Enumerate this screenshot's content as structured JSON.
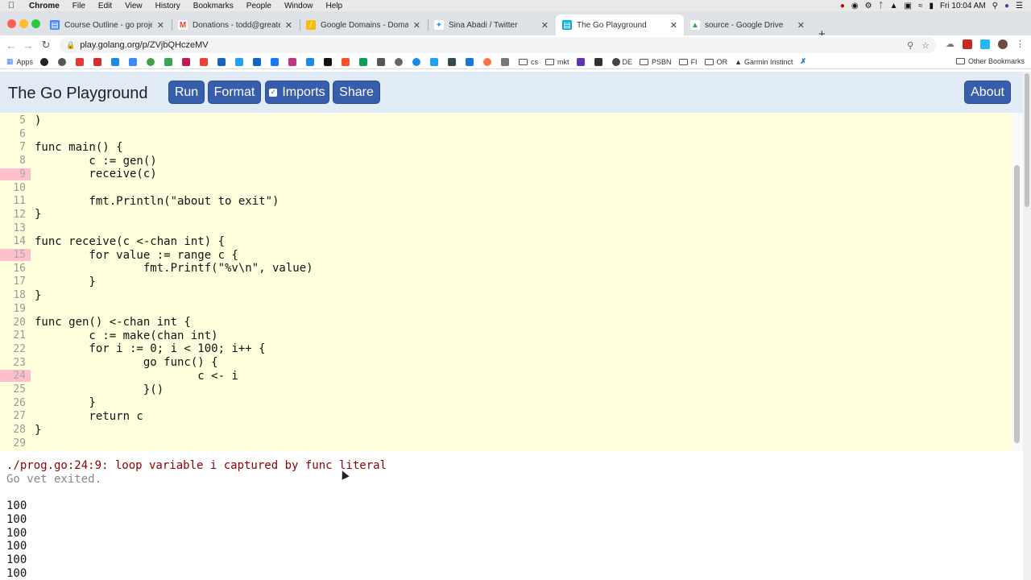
{
  "menubar": {
    "app": "Chrome",
    "items": [
      "File",
      "Edit",
      "View",
      "History",
      "Bookmarks",
      "People",
      "Window",
      "Help"
    ],
    "clock": "Fri 10:04 AM"
  },
  "tabs": [
    {
      "title": "Course Outline - go project - G",
      "icon": "google-docs-icon",
      "color": "#4285f4"
    },
    {
      "title": "Donations - todd@greatercom",
      "icon": "gmail-icon",
      "color": "#ea4335"
    },
    {
      "title": "Google Domains - Domain ove",
      "icon": "google-domains-icon",
      "color": "#fbbc04"
    },
    {
      "title": "Sina Abadi / Twitter",
      "icon": "twitter-icon",
      "color": "#1da1f2"
    },
    {
      "title": "The Go Playground",
      "icon": "go-playground-icon",
      "color": "#00add8"
    },
    {
      "title": "source - Google Drive",
      "icon": "google-drive-icon",
      "color": "#34a853"
    }
  ],
  "address": {
    "url": "play.golang.org/p/ZVjbQHczeMV"
  },
  "bookmarks": {
    "apps": "Apps",
    "labeled": [
      "cs",
      "mkt",
      "DE",
      "PSBN",
      "FI",
      "OR",
      "Garmin Instinct"
    ],
    "other": "Other Bookmarks"
  },
  "playground": {
    "title": "The Go Playground",
    "run": "Run",
    "format": "Format",
    "imports": "Imports",
    "share": "Share",
    "about": "About"
  },
  "code": [
    {
      "n": "5",
      "text": ")",
      "err": false
    },
    {
      "n": "6",
      "text": "",
      "err": false
    },
    {
      "n": "7",
      "text": "func main() {",
      "err": false
    },
    {
      "n": "8",
      "text": "        c := gen()",
      "err": false
    },
    {
      "n": "9",
      "text": "        receive(c)",
      "err": true
    },
    {
      "n": "10",
      "text": "",
      "err": false
    },
    {
      "n": "11",
      "text": "        fmt.Println(\"about to exit\")",
      "err": false
    },
    {
      "n": "12",
      "text": "}",
      "err": false
    },
    {
      "n": "13",
      "text": "",
      "err": false
    },
    {
      "n": "14",
      "text": "func receive(c <-chan int) {",
      "err": false
    },
    {
      "n": "15",
      "text": "        for value := range c {",
      "err": true
    },
    {
      "n": "16",
      "text": "                fmt.Printf(\"%v\\n\", value)",
      "err": false
    },
    {
      "n": "17",
      "text": "        }",
      "err": false
    },
    {
      "n": "18",
      "text": "}",
      "err": false
    },
    {
      "n": "19",
      "text": "",
      "err": false
    },
    {
      "n": "20",
      "text": "func gen() <-chan int {",
      "err": false
    },
    {
      "n": "21",
      "text": "        c := make(chan int)",
      "err": false
    },
    {
      "n": "22",
      "text": "        for i := 0; i < 100; i++ {",
      "err": false
    },
    {
      "n": "23",
      "text": "                go func() {",
      "err": false
    },
    {
      "n": "24",
      "text": "                        c <- i",
      "err": true
    },
    {
      "n": "25",
      "text": "                }()",
      "err": false
    },
    {
      "n": "26",
      "text": "        }",
      "err": false
    },
    {
      "n": "27",
      "text": "        return c",
      "err": false
    },
    {
      "n": "28",
      "text": "}",
      "err": false
    },
    {
      "n": "29",
      "text": "",
      "err": false
    }
  ],
  "output": {
    "error": "./prog.go:24:9: loop variable i captured by func literal",
    "system": "Go vet exited.",
    "stdout": [
      "100",
      "100",
      "100",
      "100",
      "100",
      "100"
    ]
  }
}
